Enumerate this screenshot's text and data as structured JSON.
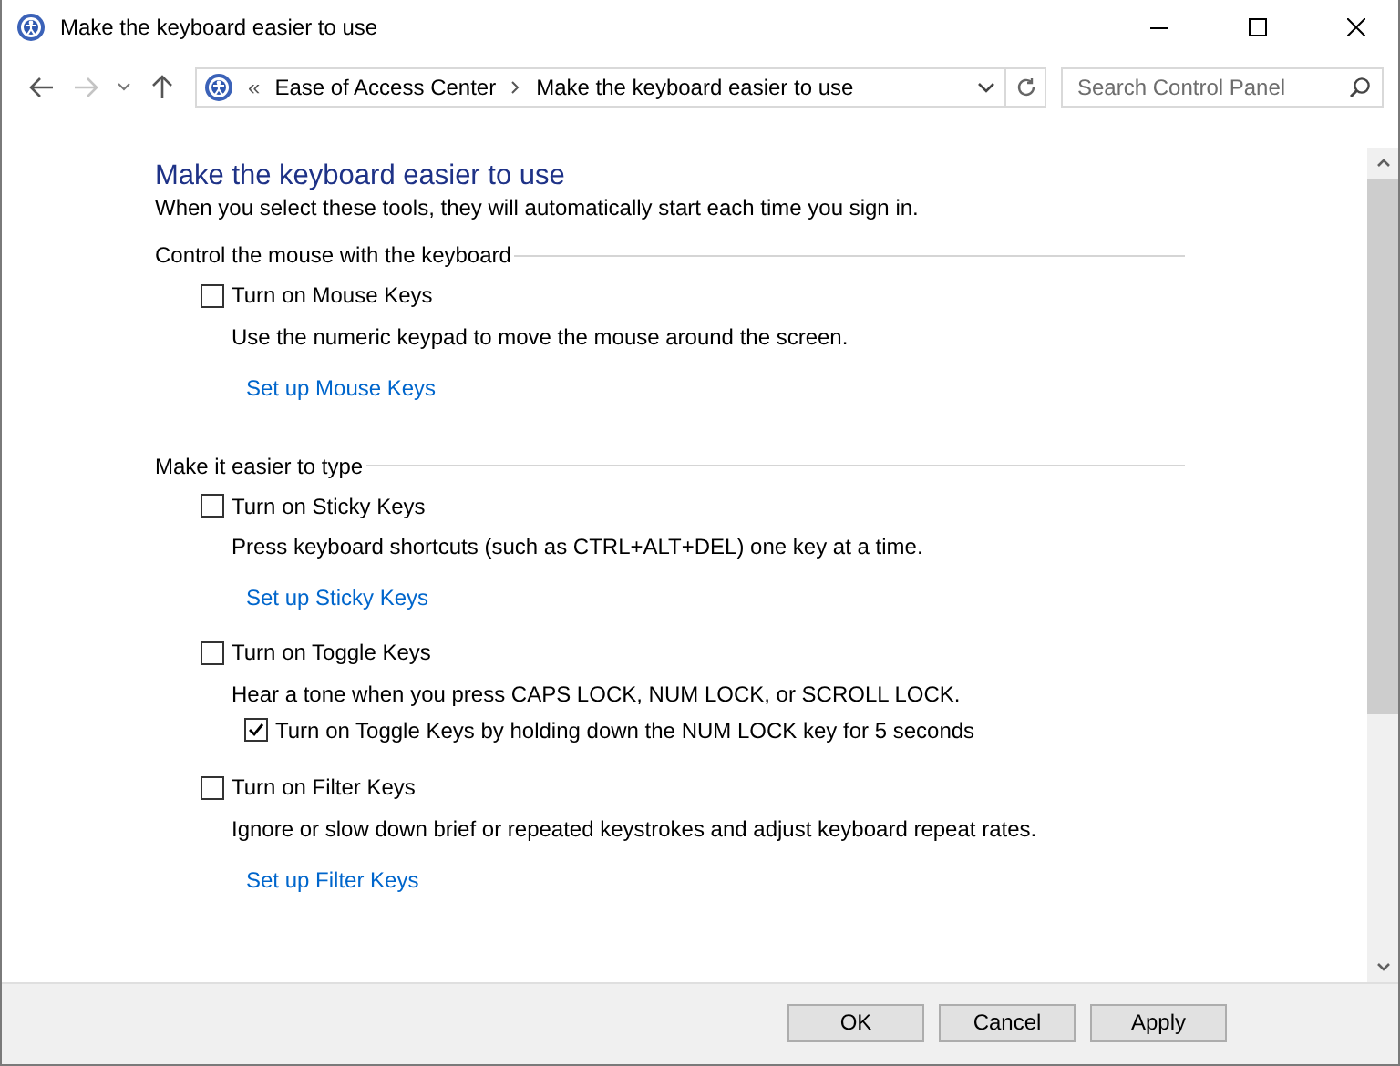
{
  "window": {
    "title": "Make the keyboard easier to use"
  },
  "address_bar": {
    "separator": "«",
    "path": [
      "Ease of Access Center",
      "Make the keyboard easier to use"
    ]
  },
  "search": {
    "placeholder": "Search Control Panel"
  },
  "page": {
    "title": "Make the keyboard easier to use",
    "subtitle": "When you select these tools, they will automatically start each time you sign in."
  },
  "sections": [
    {
      "heading": "Control the mouse with the keyboard",
      "items": [
        {
          "kind": "checkbox",
          "label": "Turn on Mouse Keys",
          "checked": false
        },
        {
          "kind": "description",
          "text": "Use the numeric keypad to move the mouse around the screen."
        },
        {
          "kind": "link",
          "text": "Set up Mouse Keys"
        }
      ]
    },
    {
      "heading": "Make it easier to type",
      "items": [
        {
          "kind": "checkbox",
          "label": "Turn on Sticky Keys",
          "checked": false
        },
        {
          "kind": "description",
          "text": "Press keyboard shortcuts (such as CTRL+ALT+DEL) one key at a time."
        },
        {
          "kind": "link",
          "text": "Set up Sticky Keys"
        },
        {
          "kind": "checkbox",
          "label": "Turn on Toggle Keys",
          "checked": false
        },
        {
          "kind": "description",
          "text": "Hear a tone when you press CAPS LOCK, NUM LOCK, or SCROLL LOCK."
        },
        {
          "kind": "subcheckbox",
          "label": "Turn on Toggle Keys by holding down the NUM LOCK key for 5 seconds",
          "checked": true
        },
        {
          "kind": "checkbox",
          "label": "Turn on Filter Keys",
          "checked": false
        },
        {
          "kind": "description",
          "text": "Ignore or slow down brief or repeated keystrokes and adjust keyboard repeat rates."
        },
        {
          "kind": "link",
          "text": "Set up Filter Keys"
        }
      ]
    }
  ],
  "buttons": [
    "OK",
    "Cancel",
    "Apply"
  ]
}
